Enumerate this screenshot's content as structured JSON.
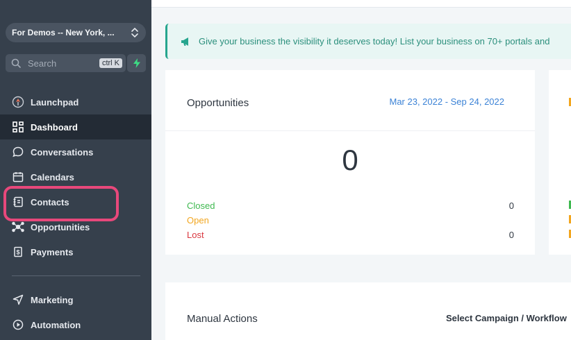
{
  "sidebar": {
    "location": "For Demos -- New York, ...",
    "search": {
      "placeholder": "Search",
      "shortcut": "ctrl K"
    },
    "items": [
      {
        "label": "Launchpad",
        "icon": "rocket-icon"
      },
      {
        "label": "Dashboard",
        "icon": "grid-icon"
      },
      {
        "label": "Conversations",
        "icon": "chat-bubble-icon"
      },
      {
        "label": "Calendars",
        "icon": "calendar-icon"
      },
      {
        "label": "Contacts",
        "icon": "contact-book-icon"
      },
      {
        "label": "Opportunities",
        "icon": "network-icon"
      },
      {
        "label": "Payments",
        "icon": "dollar-receipt-icon"
      },
      {
        "label": "Marketing",
        "icon": "send-icon"
      },
      {
        "label": "Automation",
        "icon": "automation-icon"
      }
    ],
    "active_item": "Dashboard",
    "highlighted_item": "Contacts"
  },
  "banner": {
    "text": "Give your business the visibility it deserves today! List your business on 70+ portals and"
  },
  "opportunities_card": {
    "title": "Opportunities",
    "date_range": "Mar 23, 2022 - Sep 24, 2022",
    "total": "0",
    "rows": [
      {
        "label": "Closed",
        "value": "0",
        "color": "#3fb950"
      },
      {
        "label": "Open",
        "value": "",
        "color": "#f2a61f"
      },
      {
        "label": "Lost",
        "value": "0",
        "color": "#d9363e"
      }
    ]
  },
  "manual_actions": {
    "title": "Manual Actions",
    "select_label": "Select Campaign / Workflow"
  },
  "colors": {
    "sidebar_bg": "#36404c",
    "active_bg": "#232b35",
    "accent_teal": "#26a58e",
    "highlight_pink": "#e8487b",
    "link_blue": "#3b82d6"
  }
}
